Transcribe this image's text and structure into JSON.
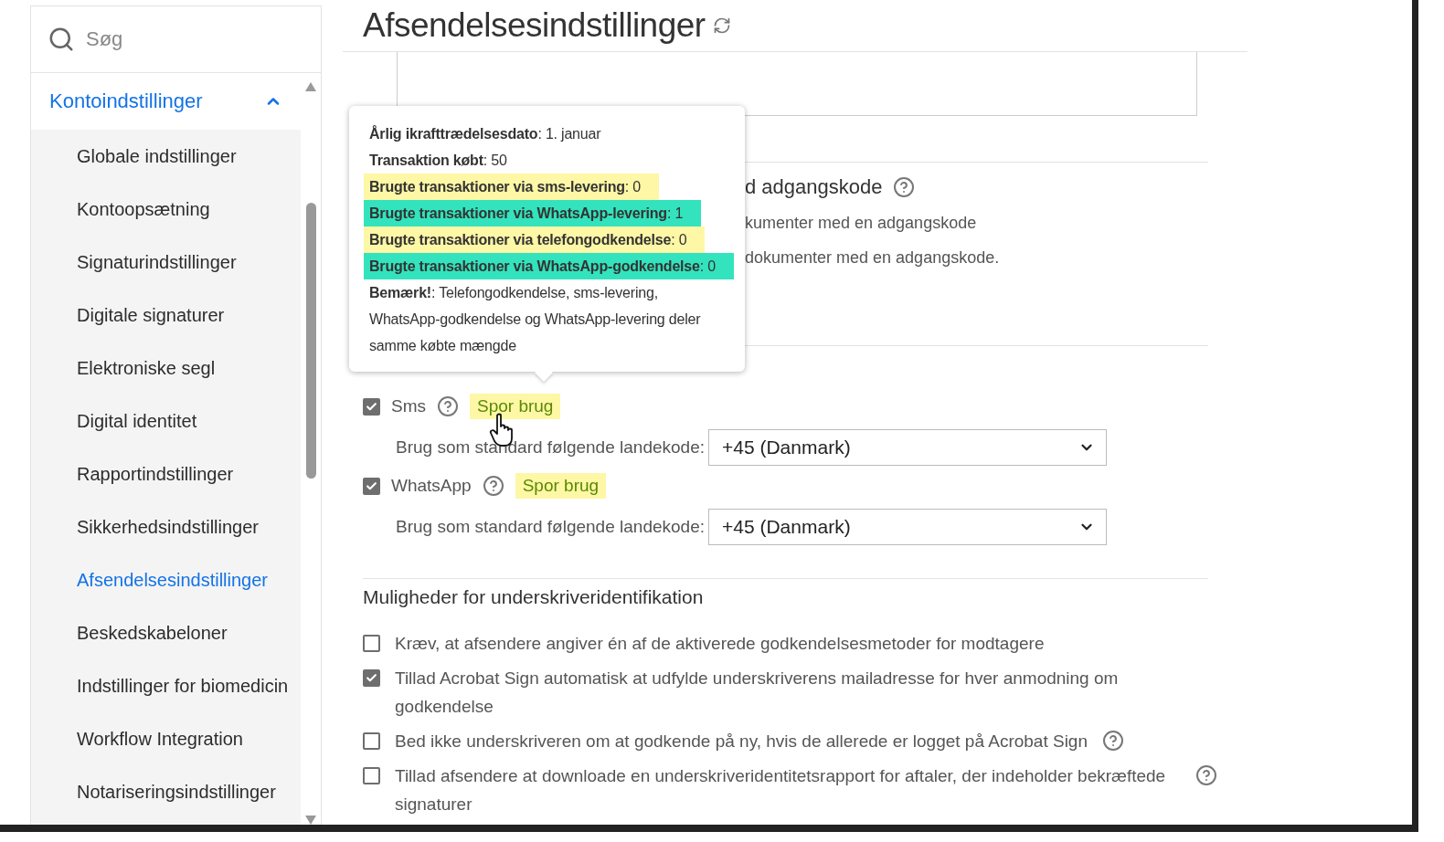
{
  "search": {
    "placeholder": "Søg"
  },
  "sidebar": {
    "section": {
      "label": "Kontoindstillinger",
      "expanded": true
    },
    "items": [
      {
        "label": "Globale indstillinger",
        "selected": false
      },
      {
        "label": "Kontoopsætning",
        "selected": false
      },
      {
        "label": "Signaturindstillinger",
        "selected": false
      },
      {
        "label": "Digitale signaturer",
        "selected": false
      },
      {
        "label": "Elektroniske segl",
        "selected": false
      },
      {
        "label": "Digital identitet",
        "selected": false
      },
      {
        "label": "Rapportindstillinger",
        "selected": false
      },
      {
        "label": "Sikkerhedsindstillinger",
        "selected": false
      },
      {
        "label": "Afsendelsesindstillinger",
        "selected": true
      },
      {
        "label": "Beskedskabeloner",
        "selected": false
      },
      {
        "label": "Indstillinger for biomedicin",
        "selected": false
      },
      {
        "label": "Workflow Integration",
        "selected": false
      },
      {
        "label": "Notariseringsindstillinger",
        "selected": false
      }
    ]
  },
  "page": {
    "title": "Afsendelsesindstillinger"
  },
  "password_section": {
    "heading": "d adgangskode",
    "lines": [
      "kumenter med en adgangskode",
      "dokumenter med en adgangskode."
    ]
  },
  "tooltip": {
    "lines": [
      {
        "text": "**Årlig ikrafttrædelsesdato**: 1. januar"
      },
      {
        "text": "**Transaktion købt**: 50"
      },
      {
        "text": "**Brugte transaktioner via sms-levering**: 0",
        "color": "#fdf7a6"
      },
      {
        "text": "**Brugte transaktioner via WhatsApp-levering**: 1",
        "color": "#33e3bd"
      },
      {
        "text": "**Brugte transaktioner via telefongodkendelse**: 0",
        "color": "#fdf7a6"
      },
      {
        "text": "**Brugte transaktioner via WhatsApp-godkendelse**: 0",
        "color": "#33e3bd"
      },
      {
        "text": "**Bemærk!**: Telefongodkendelse, sms-levering, WhatsApp-godkendelse og WhatsApp-levering deler samme købte mængde"
      }
    ]
  },
  "delivery_methods": [
    {
      "label": "Sms",
      "checked": true,
      "link": "Spor brug",
      "country_label": "Brug som standard følgende landekode:",
      "country": "+45 (Danmark)"
    },
    {
      "label": "WhatsApp",
      "checked": true,
      "link": "Spor brug",
      "country_label": "Brug som standard følgende landekode:",
      "country": "+45 (Danmark)"
    }
  ],
  "identification": {
    "heading": "Muligheder for underskriveridentifikation",
    "options": [
      {
        "label": "Kræv, at afsendere angiver én af de aktiverede godkendelsesmetoder for modtagere",
        "checked": false,
        "help": false
      },
      {
        "label": "Tillad Acrobat Sign automatisk at udfylde underskriverens mailadresse for hver anmodning om godkendelse",
        "checked": true,
        "help": false
      },
      {
        "label": "Bed ikke underskriveren om at godkende på ny, hvis de allerede er logget på Acrobat Sign",
        "checked": false,
        "help": true
      },
      {
        "label": "Tillad afsendere at downloade en underskriveridentitetsrapport for aftaler, der indeholder bekræftede signaturer",
        "checked": false,
        "help": true
      }
    ]
  }
}
